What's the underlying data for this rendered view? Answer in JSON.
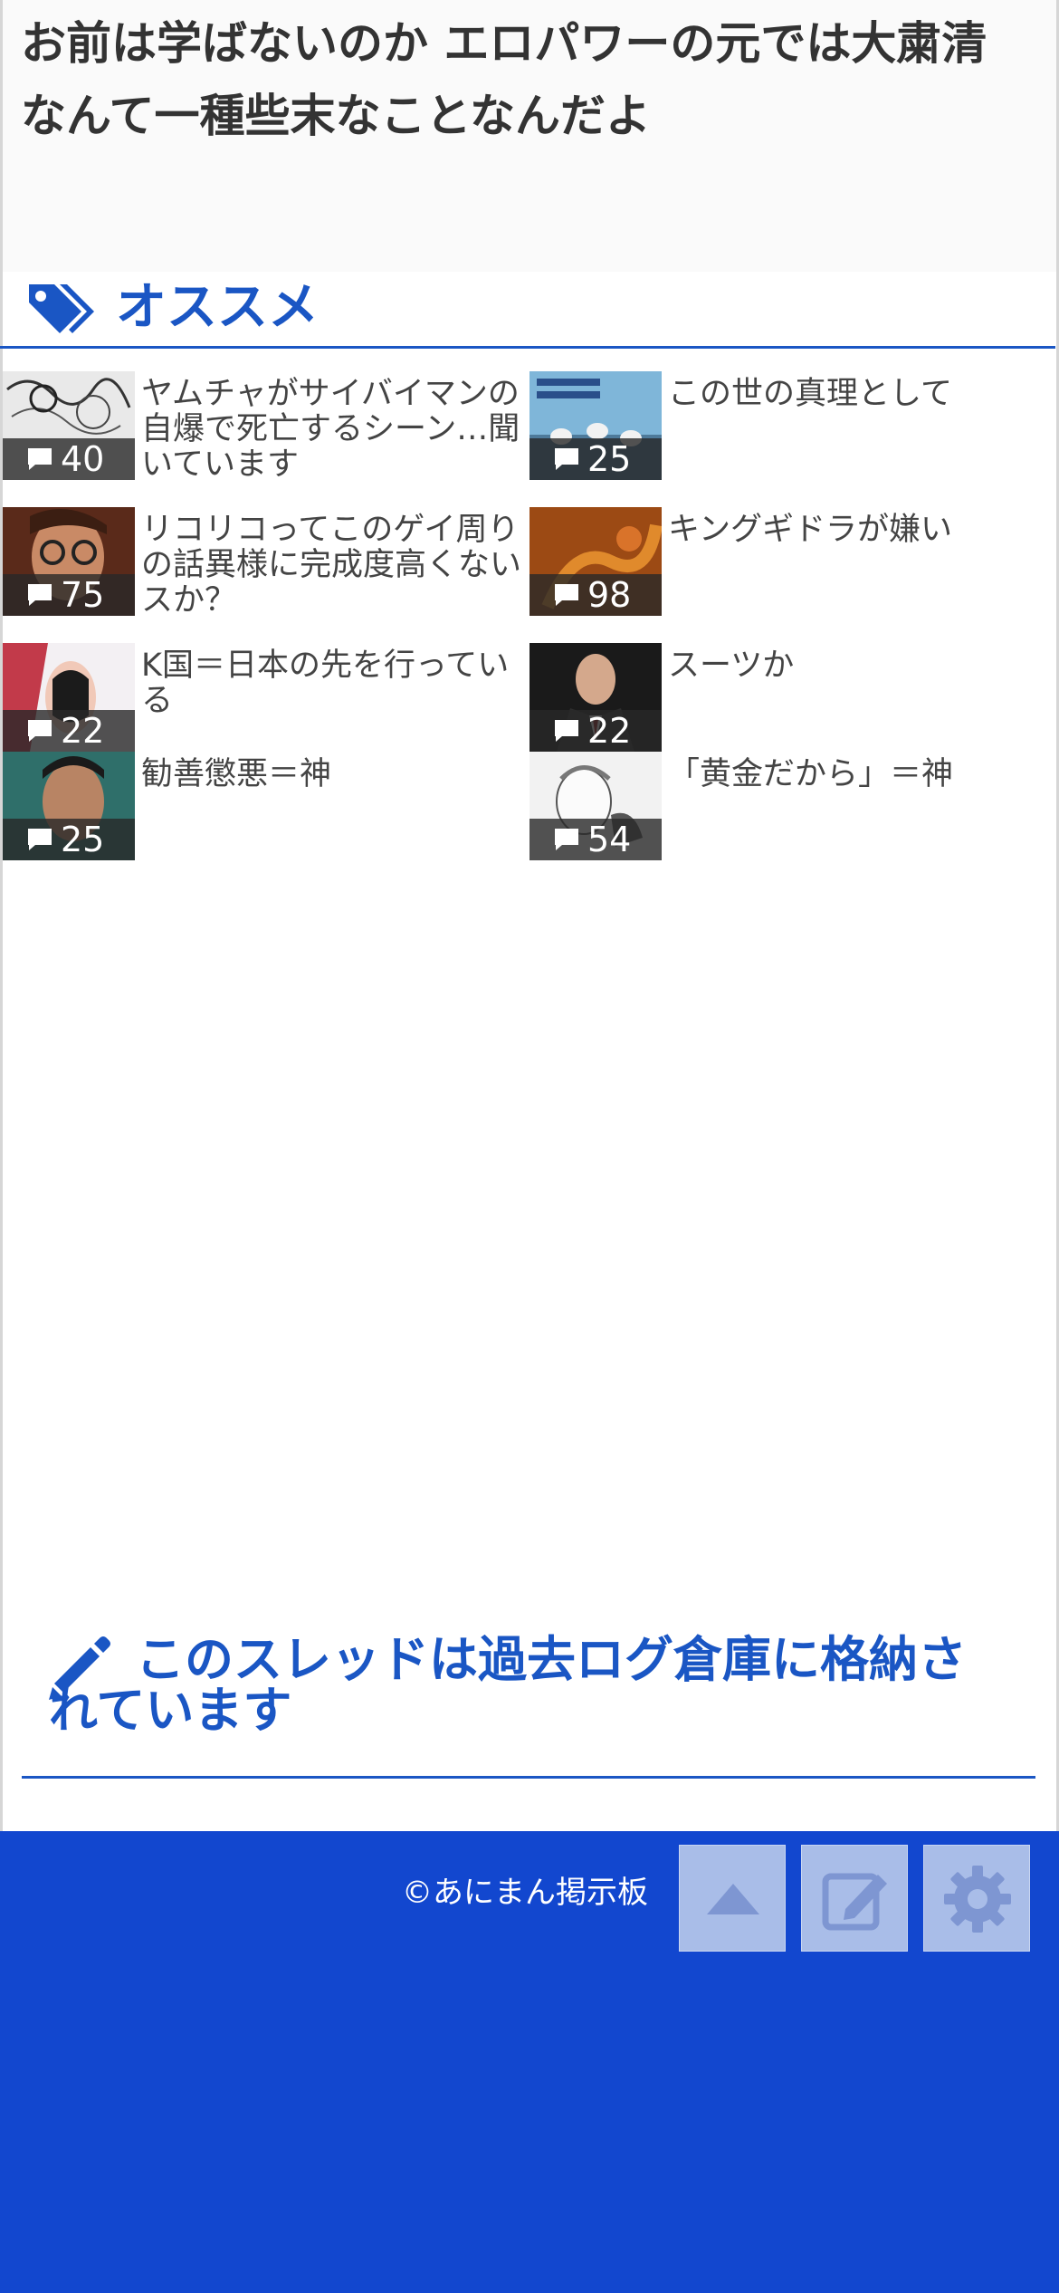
{
  "thread": {
    "title": "お前は学ばないのか エロパワーの元では大粛清なんて一種些末なことなんだよ"
  },
  "recommend": {
    "heading": "オススメ",
    "icon": "tag-icon",
    "items": [
      {
        "title": "ヤムチャがサイバイマンの自爆で死亡するシーン…聞いています",
        "count": "40"
      },
      {
        "title": "この世の真理として",
        "count": "25"
      },
      {
        "title": "リコリコってこのゲイ周りの話異様に完成度高くないスか？",
        "count": "75"
      },
      {
        "title": "キングギドラが嫌い",
        "count": "98"
      },
      {
        "title": "K国＝日本の先を行っている",
        "count": "22"
      },
      {
        "title": "スーツか",
        "count": "22"
      },
      {
        "title": "勧善懲悪＝神",
        "count": "25"
      },
      {
        "title": "「黄金だから」＝神",
        "count": "54"
      }
    ]
  },
  "archive": {
    "text": "このスレッドは過去ログ倉庫に格納されています",
    "icon": "pencil-icon"
  },
  "footer": {
    "copyright": "©あにまん掲示板",
    "buttons": [
      {
        "name": "scroll-top",
        "icon": "triangle-up-icon"
      },
      {
        "name": "write",
        "icon": "edit-icon"
      },
      {
        "name": "settings",
        "icon": "gear-icon"
      }
    ]
  },
  "colors": {
    "accent": "#1a56c4",
    "footer_bg": "#1247cf",
    "button_bg": "#a9bde8",
    "button_icon": "#7e96d2",
    "title_text": "#333333",
    "item_text": "#444444"
  }
}
